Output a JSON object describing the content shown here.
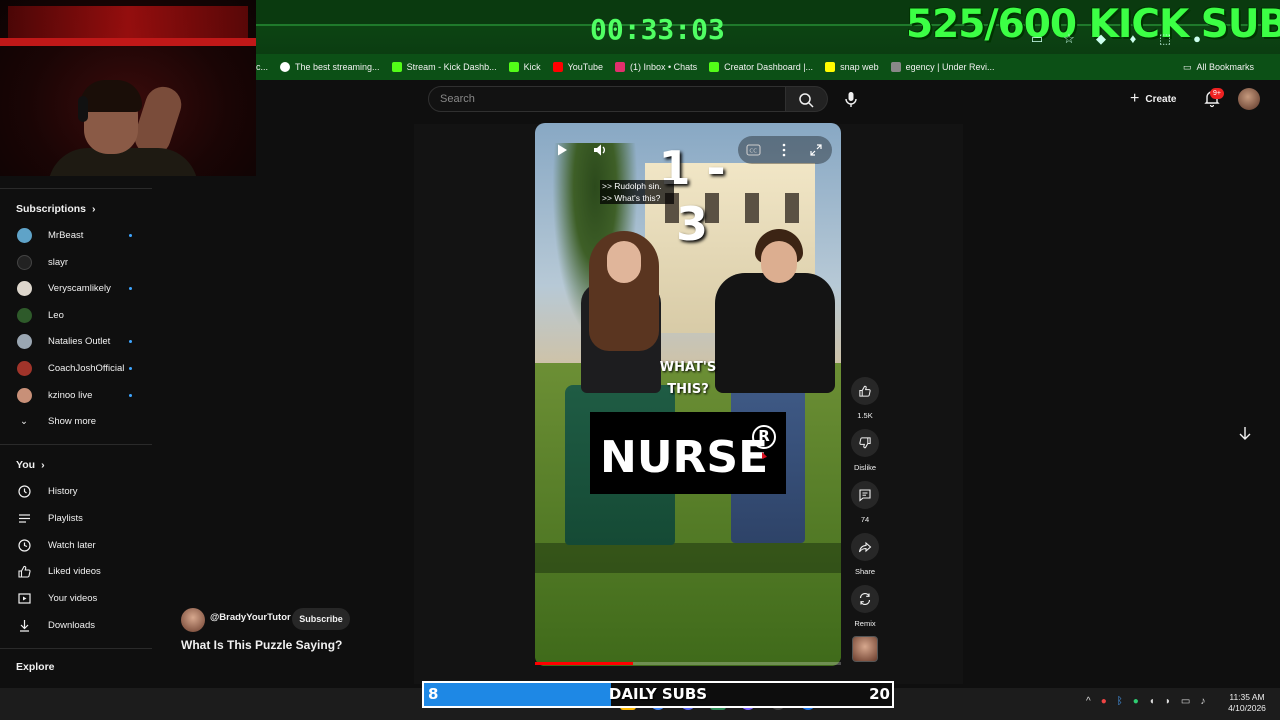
{
  "overlay": {
    "timer": "00:33:03",
    "goal": "525/600 KICK SUBS",
    "daily_subs": {
      "label": "DAILY SUBS",
      "current": "8",
      "target": "20",
      "progress": 0.4
    }
  },
  "bookmarks": {
    "items": [
      {
        "label": "c...",
        "color": "#ffffff"
      },
      {
        "label": "The best streaming...",
        "color": "#ffffff"
      },
      {
        "label": "Stream - Kick Dashb...",
        "color": "#53fc18"
      },
      {
        "label": "Kick",
        "color": "#53fc18"
      },
      {
        "label": "YouTube",
        "color": "#ff0000"
      },
      {
        "label": "(1) Inbox • Chats",
        "color": "#e1306c"
      },
      {
        "label": "Creator Dashboard |...",
        "color": "#53fc18"
      },
      {
        "label": "snap web",
        "color": "#fffc00"
      },
      {
        "label": "egency | Under Revi...",
        "color": "#dddddd"
      }
    ],
    "all_bookmarks": "All Bookmarks"
  },
  "header": {
    "search_placeholder": "Search",
    "create_label": "Create",
    "notifications_badge": "9+"
  },
  "sidebar": {
    "subscriptions_heading": "Subscriptions",
    "subscriptions": [
      {
        "name": "MrBeast",
        "color": "#5fa3c8",
        "new": true
      },
      {
        "name": "slayr",
        "color": "#222222",
        "new": false
      },
      {
        "name": "Veryscamlikely",
        "color": "#ddd6cc",
        "new": true
      },
      {
        "name": "Leo",
        "color": "#2e5a2a",
        "new": false
      },
      {
        "name": "Natalies Outlet",
        "color": "#9aa6b2",
        "new": true
      },
      {
        "name": "CoachJoshOfficial",
        "color": "#a0342a",
        "new": true
      },
      {
        "name": "kzinoo live",
        "color": "#c89078",
        "new": true
      }
    ],
    "show_more": "Show more",
    "you_heading": "You",
    "you_items": [
      "History",
      "Playlists",
      "Watch later",
      "Liked videos",
      "Your videos",
      "Downloads"
    ],
    "explore_heading": "Explore"
  },
  "short": {
    "score": "1 - 3",
    "captions": [
      ">> Rudolph sin.",
      ">> What's this?"
    ],
    "overlay_text": "WHAT'S THIS?",
    "puzzle_word": "NURSE",
    "puzzle_symbol": "R",
    "progress": 0.32,
    "channel_handle": "@BradyYourTutor",
    "subscribe_label": "Subscribe",
    "title": "What Is This Puzzle Saying?",
    "actions": {
      "likes": "1.5K",
      "dislike": "Dislike",
      "comments": "74",
      "share": "Share",
      "remix": "Remix"
    }
  },
  "taskbar": {
    "time": "11:35 AM",
    "date": "4/10/2026"
  }
}
